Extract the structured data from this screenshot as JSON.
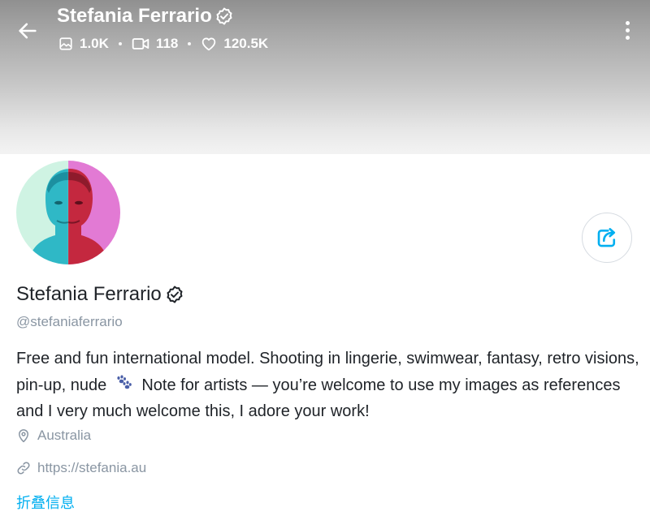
{
  "header": {
    "name": "Stefania Ferrario",
    "stats": {
      "photos": "1.0K",
      "videos": "118",
      "likes": "120.5K"
    }
  },
  "profile": {
    "display_name": "Stefania Ferrario",
    "handle": "@stefaniaferrario",
    "bio_part1": "Free and fun international model. Shooting in lingerie, swimwear, fantasy, retro visions, pin-up, nude",
    "bio_part2": "Note for artists — you’re welcome to use my images as references and I very much welcome this, I adore your work!",
    "location": "Australia",
    "website": "https://stefania.au",
    "collapse_label": "折叠信息"
  },
  "icons": {
    "back": "arrow-left-icon",
    "more": "more-vertical-icon",
    "share": "share-icon",
    "verified": "verified-badge-icon",
    "photos": "image-icon",
    "videos": "video-icon",
    "likes": "heart-icon",
    "location": "map-pin-icon",
    "website": "link-icon",
    "bio_emoji": "paw-prints-icon"
  },
  "colors": {
    "accent": "#00aff0",
    "muted_text": "#8a96a3",
    "primary_text": "#1f2328"
  }
}
